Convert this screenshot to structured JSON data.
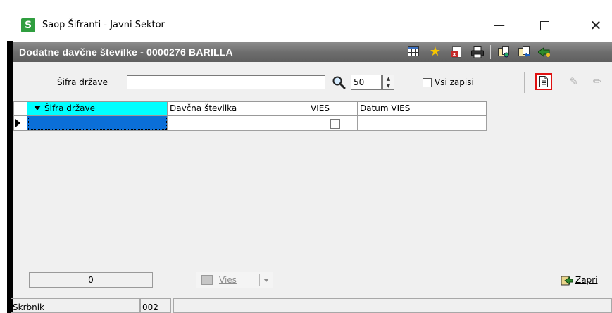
{
  "window": {
    "app_logo": "S",
    "title": "Saop Šifranti - Javni Sektor"
  },
  "form": {
    "title": "Dodatne davčne številke - 0000276 BARILLA"
  },
  "toolbar": {
    "sifra_label": "Šifra države",
    "sifra_value": "",
    "count_value": "50",
    "vsi_label": "Vsi zapisi"
  },
  "grid": {
    "columns": [
      "Šifra države",
      "Davčna številka",
      "VIES",
      "Datum VIES"
    ],
    "rows": [
      {
        "sifra": "",
        "davcna": "",
        "vies": false,
        "datum": ""
      }
    ]
  },
  "bottom": {
    "record_count": "0",
    "vies_label": "Vies",
    "zapri_label": "Zapri"
  },
  "status": {
    "user": "Skrbnik",
    "code": "002",
    "message": ""
  },
  "colors": {
    "header_gradient": "#6e6e6e",
    "selected_cell": "#0b6fd8",
    "sort_column": "#00ffff",
    "highlight": "#e01010",
    "logo": "#2f9e3f"
  },
  "icons": [
    "app-logo-icon",
    "minimize-icon",
    "maximize-icon",
    "close-icon",
    "columns-icon",
    "favorite-star-icon",
    "export-excel-icon",
    "print-icon",
    "copy-record-icon",
    "paste-record-icon",
    "exit-run-icon",
    "search-icon",
    "new-record-icon",
    "edit-record-icon",
    "delete-record-icon",
    "vies-icon",
    "close-form-icon"
  ]
}
